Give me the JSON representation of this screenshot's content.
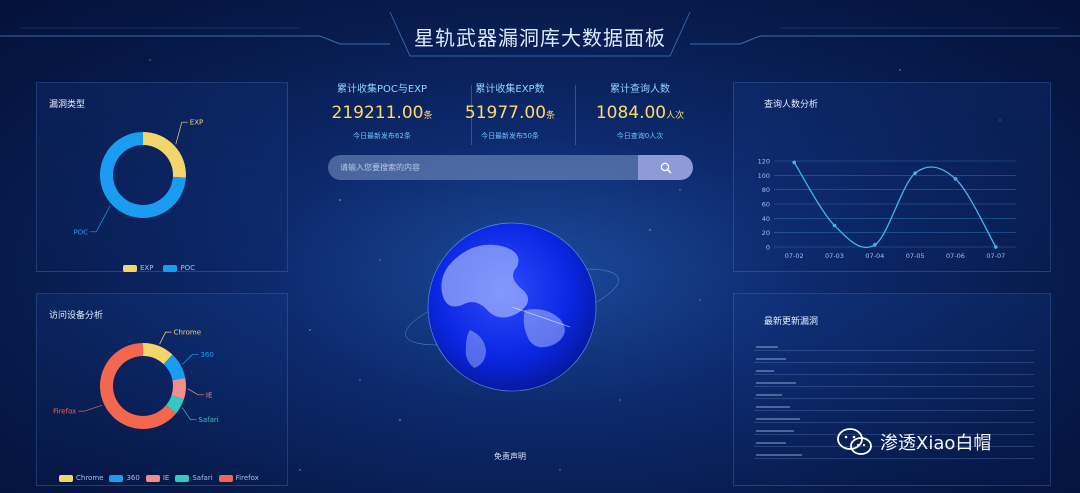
{
  "header": {
    "title": "星轨武器漏洞库大数据面板"
  },
  "vuln_type": {
    "title": "漏洞类型",
    "slices": [
      {
        "label": "EXP",
        "value": 26,
        "color": "#f3d66b"
      },
      {
        "label": "POC",
        "value": 74,
        "color": "#1a9cf0"
      }
    ]
  },
  "device": {
    "title": "访问设备分析",
    "slices": [
      {
        "label": "Chrome",
        "value": 12,
        "color": "#f3d66b"
      },
      {
        "label": "360",
        "value": 10,
        "color": "#1a9cf0"
      },
      {
        "label": "IE",
        "value": 8,
        "color": "#f08f87"
      },
      {
        "label": "Safari",
        "value": 6,
        "color": "#35c8c0"
      },
      {
        "label": "Firefox",
        "value": 64,
        "color": "#f2674e"
      }
    ]
  },
  "stats": [
    {
      "label": "累计收集POC与EXP",
      "value": "219211.00",
      "unit": "条",
      "sub": "今日最新发布62条"
    },
    {
      "label": "累计收集EXP数",
      "value": "51977.00",
      "unit": "条",
      "sub": "今日最新发布50条"
    },
    {
      "label": "累计查询人数",
      "value": "1084.00",
      "unit": "人次",
      "sub": "今日查询0人次"
    }
  ],
  "search": {
    "placeholder": "请输入您要搜索的内容",
    "button_icon": "search-icon"
  },
  "query_chart": {
    "title": "查询人数分析",
    "chart_data": {
      "type": "line",
      "categories": [
        "07-02",
        "07-03",
        "07-04",
        "07-05",
        "07-06",
        "07-07"
      ],
      "values": [
        118,
        30,
        3,
        103,
        95,
        0
      ],
      "ylim": [
        0,
        120
      ],
      "yticks": [
        "0",
        "20",
        "40",
        "60",
        "80",
        "100",
        "120"
      ],
      "grid": true,
      "color": "#3fb8e8"
    }
  },
  "latest": {
    "title": "最新更新漏洞"
  },
  "footer": {
    "disclaimer": "免责声明"
  },
  "watermark": {
    "text": "渗透Xiao白帽",
    "icon": "wechat-icon"
  },
  "colors": {
    "accent": "#ffd86b",
    "label": "#8fd6ff"
  }
}
